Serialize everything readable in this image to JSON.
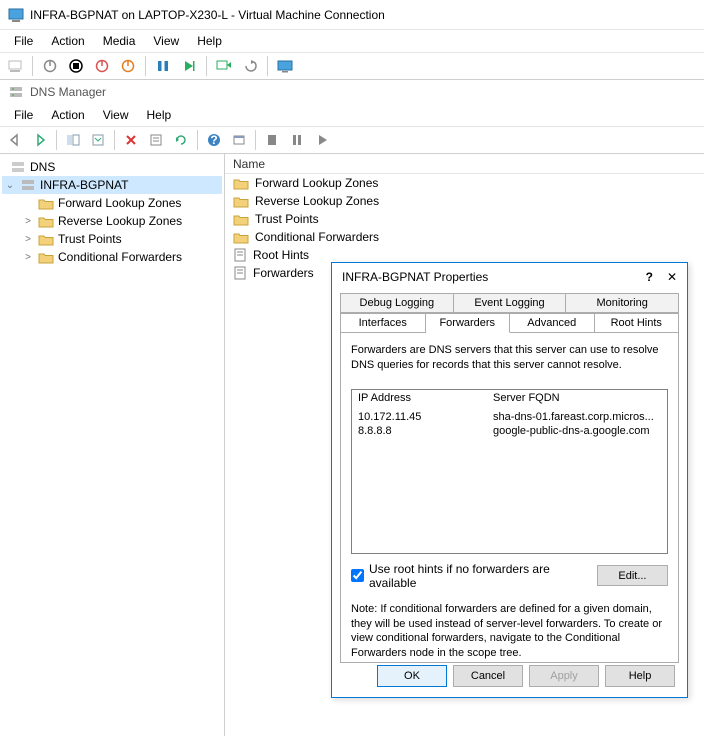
{
  "window": {
    "title": "INFRA-BGPNAT on LAPTOP-X230-L - Virtual Machine Connection"
  },
  "vm_menubar": [
    "File",
    "Action",
    "Media",
    "View",
    "Help"
  ],
  "mmc": {
    "title": "DNS Manager",
    "menubar": [
      "File",
      "Action",
      "View",
      "Help"
    ]
  },
  "tree": {
    "root": "DNS",
    "server": "INFRA-BGPNAT",
    "nodes": [
      {
        "label": "Forward Lookup Zones",
        "twisty": ""
      },
      {
        "label": "Reverse Lookup Zones",
        "twisty": ">"
      },
      {
        "label": "Trust Points",
        "twisty": ">"
      },
      {
        "label": "Conditional Forwarders",
        "twisty": ">"
      }
    ]
  },
  "list": {
    "header": "Name",
    "items": [
      "Forward Lookup Zones",
      "Reverse Lookup Zones",
      "Trust Points",
      "Conditional Forwarders",
      "Root Hints",
      "Forwarders"
    ]
  },
  "dialog": {
    "title": "INFRA-BGPNAT Properties",
    "tabs_row1": [
      "Debug Logging",
      "Event Logging",
      "Monitoring"
    ],
    "tabs_row2": [
      "Interfaces",
      "Forwarders",
      "Advanced",
      "Root Hints"
    ],
    "active_tab": "Forwarders",
    "description": "Forwarders are DNS servers that this server can use to resolve DNS queries for records that this server cannot resolve.",
    "grid": {
      "headers": {
        "ip": "IP Address",
        "fqdn": "Server FQDN"
      },
      "rows": [
        {
          "ip": "10.172.11.45",
          "fqdn": "sha-dns-01.fareast.corp.micros..."
        },
        {
          "ip": "8.8.8.8",
          "fqdn": "google-public-dns-a.google.com"
        }
      ]
    },
    "checkbox_label": "Use root hints if no forwarders are available",
    "checkbox_checked": true,
    "edit_button": "Edit...",
    "note": "Note: If conditional forwarders are defined for a given domain, they will be used instead of server-level forwarders.  To create or view conditional forwarders, navigate to the Conditional Forwarders node in the scope tree.",
    "buttons": {
      "ok": "OK",
      "cancel": "Cancel",
      "apply": "Apply",
      "help": "Help"
    }
  }
}
